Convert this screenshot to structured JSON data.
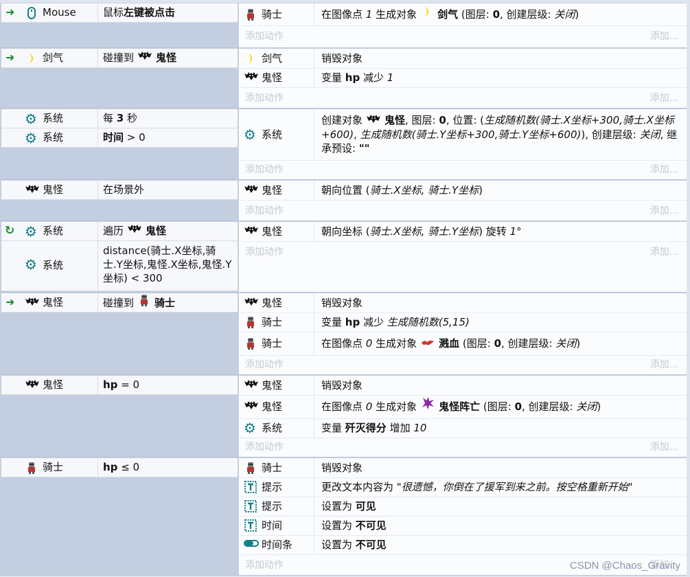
{
  "events": [
    {
      "conditions": [
        {
          "lead": "arrow",
          "obj": "Mouse",
          "obj_icon": "mouse-icon",
          "parts": [
            {
              "t": "鼠标",
              "s": ""
            },
            {
              "t": "左键被点击",
              "s": "b"
            }
          ]
        }
      ],
      "actions": [
        {
          "obj": "骑士",
          "obj_icon": "knight-sprite-icon",
          "parts": [
            {
              "t": "在图像点 ",
              "s": ""
            },
            {
              "t": "1",
              "s": "i"
            },
            {
              "t": " 生成对象 ",
              "s": ""
            },
            {
              "t": "moon-sprite-icon",
              "s": "icon"
            },
            {
              "t": " 剑气",
              "s": "b"
            },
            {
              "t": " (图层: ",
              "s": ""
            },
            {
              "t": "0",
              "s": "b"
            },
            {
              "t": ", 创建层级: ",
              "s": ""
            },
            {
              "t": "关闭",
              "s": "i"
            },
            {
              "t": ")",
              "s": ""
            }
          ]
        }
      ]
    },
    {
      "conditions": [
        {
          "lead": "arrow",
          "obj": "剑气",
          "obj_icon": "moon-sprite-icon",
          "parts": [
            {
              "t": "碰撞到 ",
              "s": ""
            },
            {
              "t": "bat-sprite-icon",
              "s": "icon"
            },
            {
              "t": " 鬼怪",
              "s": "b"
            }
          ]
        }
      ],
      "actions": [
        {
          "obj": "剑气",
          "obj_icon": "moon-sprite-icon",
          "parts": [
            {
              "t": "销毁对象",
              "s": ""
            }
          ]
        },
        {
          "obj": "鬼怪",
          "obj_icon": "bat-sprite-icon",
          "parts": [
            {
              "t": "变量 ",
              "s": ""
            },
            {
              "t": "hp",
              "s": "b"
            },
            {
              "t": " 减少 ",
              "s": ""
            },
            {
              "t": "1",
              "s": "i"
            }
          ]
        }
      ]
    },
    {
      "conditions": [
        {
          "lead": "",
          "obj": "系统",
          "obj_icon": "gear-icon",
          "parts": [
            {
              "t": "每 ",
              "s": ""
            },
            {
              "t": "3",
              "s": "b"
            },
            {
              "t": " 秒",
              "s": ""
            }
          ]
        },
        {
          "lead": "",
          "obj": "系统",
          "obj_icon": "gear-icon",
          "parts": [
            {
              "t": "时间",
              "s": "b"
            },
            {
              "t": " > 0",
              "s": ""
            }
          ]
        }
      ],
      "actions": [
        {
          "obj": "系统",
          "obj_icon": "gear-icon",
          "tall": true,
          "parts": [
            {
              "t": "创建对象 ",
              "s": ""
            },
            {
              "t": "bat-sprite-icon",
              "s": "icon"
            },
            {
              "t": " 鬼怪",
              "s": "b"
            },
            {
              "t": ", 图层: ",
              "s": ""
            },
            {
              "t": "0",
              "s": "b"
            },
            {
              "t": ", 位置: (",
              "s": ""
            },
            {
              "t": "生成随机数(骑士.X坐标+300,骑士.X坐标+600)",
              "s": "i"
            },
            {
              "t": ", ",
              "s": ""
            },
            {
              "t": "生成随机数(骑士.Y坐标+300,骑士.Y坐标+600)",
              "s": "i"
            },
            {
              "t": "), 创建层级: ",
              "s": ""
            },
            {
              "t": "关闭",
              "s": "i"
            },
            {
              "t": ", 继承预设: ",
              "s": ""
            },
            {
              "t": "\"\"",
              "s": "b"
            }
          ]
        }
      ]
    },
    {
      "conditions": [
        {
          "lead": "",
          "obj": "鬼怪",
          "obj_icon": "bat-sprite-icon",
          "parts": [
            {
              "t": "在场景外",
              "s": ""
            }
          ]
        }
      ],
      "actions": [
        {
          "obj": "鬼怪",
          "obj_icon": "bat-sprite-icon",
          "parts": [
            {
              "t": "朝向位置 (",
              "s": ""
            },
            {
              "t": "骑士.X坐标, 骑士.Y坐标",
              "s": "i"
            },
            {
              "t": ")",
              "s": ""
            }
          ]
        }
      ]
    },
    {
      "conditions": [
        {
          "lead": "cycle",
          "obj": "系统",
          "obj_icon": "gear-icon",
          "parts": [
            {
              "t": "遍历 ",
              "s": ""
            },
            {
              "t": "bat-sprite-icon",
              "s": "icon"
            },
            {
              "t": " 鬼怪",
              "s": "b"
            }
          ]
        },
        {
          "lead": "",
          "obj": "系统",
          "obj_icon": "gear-icon",
          "tall": true,
          "parts": [
            {
              "t": "distance(骑士.X坐标,骑士.Y坐标,鬼怪.X坐标,鬼怪.Y坐标) < 300",
              "s": ""
            }
          ]
        }
      ],
      "actions": [
        {
          "obj": "鬼怪",
          "obj_icon": "bat-sprite-icon",
          "parts": [
            {
              "t": "朝向坐标 (",
              "s": ""
            },
            {
              "t": "骑士.X坐标, 骑士.Y坐标",
              "s": "i"
            },
            {
              "t": ") 旋转 ",
              "s": ""
            },
            {
              "t": "1°",
              "s": "i"
            }
          ]
        }
      ]
    },
    {
      "conditions": [
        {
          "lead": "arrow",
          "obj": "鬼怪",
          "obj_icon": "bat-sprite-icon",
          "parts": [
            {
              "t": "碰撞到 ",
              "s": ""
            },
            {
              "t": "knight-sprite-icon",
              "s": "icon"
            },
            {
              "t": " 骑士",
              "s": "b"
            }
          ]
        }
      ],
      "actions": [
        {
          "obj": "鬼怪",
          "obj_icon": "bat-sprite-icon",
          "parts": [
            {
              "t": "销毁对象",
              "s": ""
            }
          ]
        },
        {
          "obj": "骑士",
          "obj_icon": "knight-sprite-icon",
          "parts": [
            {
              "t": "变量 ",
              "s": ""
            },
            {
              "t": "hp",
              "s": "b"
            },
            {
              "t": " 减少 ",
              "s": ""
            },
            {
              "t": "生成随机数(5,15)",
              "s": "i"
            }
          ]
        },
        {
          "obj": "骑士",
          "obj_icon": "knight-sprite-icon",
          "parts": [
            {
              "t": "在图像点 ",
              "s": ""
            },
            {
              "t": "0",
              "s": "i"
            },
            {
              "t": " 生成对象 ",
              "s": ""
            },
            {
              "t": "blood-sprite-icon",
              "s": "icon"
            },
            {
              "t": " 溅血",
              "s": "b"
            },
            {
              "t": " (图层: ",
              "s": ""
            },
            {
              "t": "0",
              "s": "b"
            },
            {
              "t": ", 创建层级: ",
              "s": ""
            },
            {
              "t": "关闭",
              "s": "i"
            },
            {
              "t": ")",
              "s": ""
            }
          ]
        }
      ]
    },
    {
      "conditions": [
        {
          "lead": "",
          "obj": "鬼怪",
          "obj_icon": "bat-sprite-icon",
          "parts": [
            {
              "t": "hp",
              "s": "b"
            },
            {
              "t": " = 0",
              "s": ""
            }
          ]
        }
      ],
      "actions": [
        {
          "obj": "鬼怪",
          "obj_icon": "bat-sprite-icon",
          "parts": [
            {
              "t": "销毁对象",
              "s": ""
            }
          ]
        },
        {
          "obj": "鬼怪",
          "obj_icon": "bat-sprite-icon",
          "parts": [
            {
              "t": "在图像点 ",
              "s": ""
            },
            {
              "t": "0",
              "s": "i"
            },
            {
              "t": " 生成对象 ",
              "s": ""
            },
            {
              "t": "splat-sprite-icon",
              "s": "icon"
            },
            {
              "t": " 鬼怪阵亡",
              "s": "b"
            },
            {
              "t": " (图层: ",
              "s": ""
            },
            {
              "t": "0",
              "s": "b"
            },
            {
              "t": ", 创建层级: ",
              "s": ""
            },
            {
              "t": "关闭",
              "s": "i"
            },
            {
              "t": ")",
              "s": ""
            }
          ]
        },
        {
          "obj": "系统",
          "obj_icon": "gear-icon",
          "parts": [
            {
              "t": "变量 ",
              "s": ""
            },
            {
              "t": "歼灭得分",
              "s": "b"
            },
            {
              "t": " 增加 ",
              "s": ""
            },
            {
              "t": "10",
              "s": "i"
            }
          ]
        }
      ]
    },
    {
      "conditions": [
        {
          "lead": "",
          "obj": "骑士",
          "obj_icon": "knight-sprite-icon",
          "parts": [
            {
              "t": "hp",
              "s": "b"
            },
            {
              "t": " ≤ 0",
              "s": ""
            }
          ]
        }
      ],
      "actions": [
        {
          "obj": "骑士",
          "obj_icon": "knight-sprite-icon",
          "parts": [
            {
              "t": "销毁对象",
              "s": ""
            }
          ]
        },
        {
          "obj": "提示",
          "obj_icon": "text-object-icon",
          "parts": [
            {
              "t": "更改文本内容为 ",
              "s": ""
            },
            {
              "t": "\"很遗憾，你倒在了援军到来之前。按空格重新开始\"",
              "s": "i"
            }
          ]
        },
        {
          "obj": "提示",
          "obj_icon": "text-object-icon",
          "parts": [
            {
              "t": "设置为 ",
              "s": ""
            },
            {
              "t": "可见",
              "s": "b"
            }
          ]
        },
        {
          "obj": "时间",
          "obj_icon": "text-object-icon",
          "parts": [
            {
              "t": "设置为 ",
              "s": ""
            },
            {
              "t": "不可见",
              "s": "b"
            }
          ]
        },
        {
          "obj": "时间条",
          "obj_icon": "progress-bar-icon",
          "parts": [
            {
              "t": "设置为 ",
              "s": ""
            },
            {
              "t": "不可见",
              "s": "b"
            }
          ]
        }
      ]
    }
  ],
  "labels": {
    "add_action": "添加动作",
    "add_more": "添加..."
  },
  "watermark": "CSDN @Chaos_Gravity",
  "colors": {
    "accent_arrow": "#1e8c35",
    "gear": "#127e8a",
    "condition_bg": "#c3cfe0"
  }
}
